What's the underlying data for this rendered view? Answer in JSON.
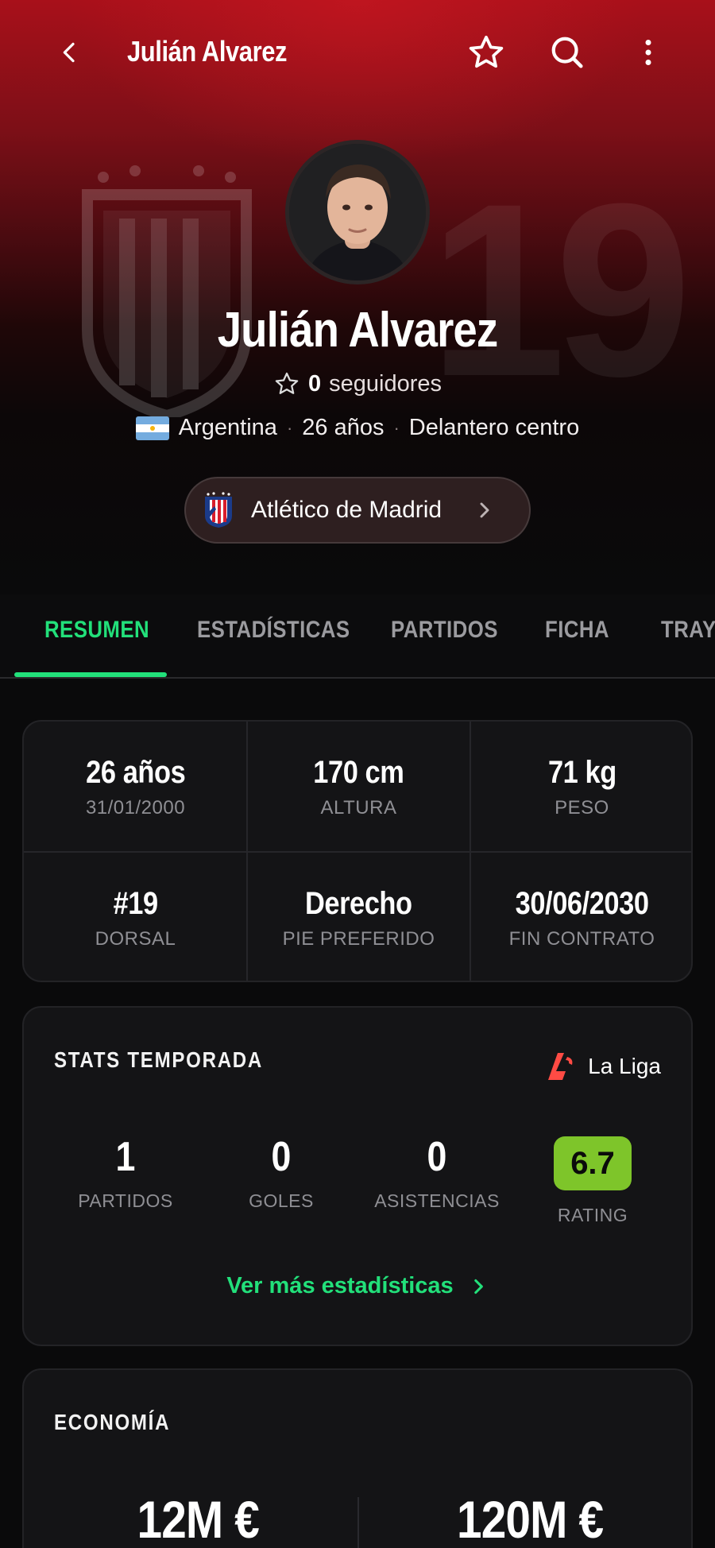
{
  "topbar": {
    "title": "Julián Alvarez"
  },
  "hero": {
    "shirt_number_watermark": "19",
    "player_name": "Julián Alvarez",
    "followers_count": "0",
    "followers_label": "seguidores",
    "country": "Argentina",
    "age": "26 años",
    "position": "Delantero centro",
    "club": "Atlético de Madrid"
  },
  "tabs": [
    "RESUMEN",
    "ESTADÍSTICAS",
    "PARTIDOS",
    "FICHA",
    "TRAYECTORIA"
  ],
  "info": {
    "age": {
      "value": "26 años",
      "label": "31/01/2000"
    },
    "height": {
      "value": "170 cm",
      "label": "ALTURA"
    },
    "weight": {
      "value": "71 kg",
      "label": "PESO"
    },
    "number": {
      "value": "#19",
      "label": "DORSAL"
    },
    "foot": {
      "value": "Derecho",
      "label": "PIE PREFERIDO"
    },
    "contract": {
      "value": "30/06/2030",
      "label": "FIN CONTRATO"
    }
  },
  "season_stats": {
    "title": "STATS TEMPORADA",
    "league": "La Liga",
    "matches": {
      "value": "1",
      "label": "PARTIDOS"
    },
    "goals": {
      "value": "0",
      "label": "GOLES"
    },
    "assists": {
      "value": "0",
      "label": "ASISTENCIAS"
    },
    "rating": {
      "value": "6.7",
      "label": "RATING"
    },
    "more_link": "Ver más estadísticas"
  },
  "economy": {
    "title": "ECONOMÍA",
    "value_left": "12M €",
    "value_right": "120M €"
  },
  "colors": {
    "accent_green": "#22e07a",
    "rating_green": "#7ec52a",
    "hero_red": "#a8101a",
    "laliga_red": "#ff4b44"
  }
}
